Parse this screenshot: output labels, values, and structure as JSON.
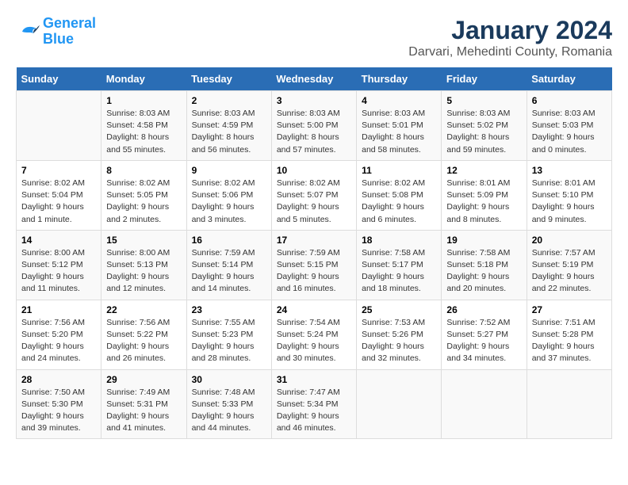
{
  "logo": {
    "line1": "General",
    "line2": "Blue"
  },
  "title": "January 2024",
  "subtitle": "Darvari, Mehedinti County, Romania",
  "header_days": [
    "Sunday",
    "Monday",
    "Tuesday",
    "Wednesday",
    "Thursday",
    "Friday",
    "Saturday"
  ],
  "weeks": [
    [
      {
        "day": "",
        "info": ""
      },
      {
        "day": "1",
        "info": "Sunrise: 8:03 AM\nSunset: 4:58 PM\nDaylight: 8 hours\nand 55 minutes."
      },
      {
        "day": "2",
        "info": "Sunrise: 8:03 AM\nSunset: 4:59 PM\nDaylight: 8 hours\nand 56 minutes."
      },
      {
        "day": "3",
        "info": "Sunrise: 8:03 AM\nSunset: 5:00 PM\nDaylight: 8 hours\nand 57 minutes."
      },
      {
        "day": "4",
        "info": "Sunrise: 8:03 AM\nSunset: 5:01 PM\nDaylight: 8 hours\nand 58 minutes."
      },
      {
        "day": "5",
        "info": "Sunrise: 8:03 AM\nSunset: 5:02 PM\nDaylight: 8 hours\nand 59 minutes."
      },
      {
        "day": "6",
        "info": "Sunrise: 8:03 AM\nSunset: 5:03 PM\nDaylight: 9 hours\nand 0 minutes."
      }
    ],
    [
      {
        "day": "7",
        "info": "Sunrise: 8:02 AM\nSunset: 5:04 PM\nDaylight: 9 hours\nand 1 minute."
      },
      {
        "day": "8",
        "info": "Sunrise: 8:02 AM\nSunset: 5:05 PM\nDaylight: 9 hours\nand 2 minutes."
      },
      {
        "day": "9",
        "info": "Sunrise: 8:02 AM\nSunset: 5:06 PM\nDaylight: 9 hours\nand 3 minutes."
      },
      {
        "day": "10",
        "info": "Sunrise: 8:02 AM\nSunset: 5:07 PM\nDaylight: 9 hours\nand 5 minutes."
      },
      {
        "day": "11",
        "info": "Sunrise: 8:02 AM\nSunset: 5:08 PM\nDaylight: 9 hours\nand 6 minutes."
      },
      {
        "day": "12",
        "info": "Sunrise: 8:01 AM\nSunset: 5:09 PM\nDaylight: 9 hours\nand 8 minutes."
      },
      {
        "day": "13",
        "info": "Sunrise: 8:01 AM\nSunset: 5:10 PM\nDaylight: 9 hours\nand 9 minutes."
      }
    ],
    [
      {
        "day": "14",
        "info": "Sunrise: 8:00 AM\nSunset: 5:12 PM\nDaylight: 9 hours\nand 11 minutes."
      },
      {
        "day": "15",
        "info": "Sunrise: 8:00 AM\nSunset: 5:13 PM\nDaylight: 9 hours\nand 12 minutes."
      },
      {
        "day": "16",
        "info": "Sunrise: 7:59 AM\nSunset: 5:14 PM\nDaylight: 9 hours\nand 14 minutes."
      },
      {
        "day": "17",
        "info": "Sunrise: 7:59 AM\nSunset: 5:15 PM\nDaylight: 9 hours\nand 16 minutes."
      },
      {
        "day": "18",
        "info": "Sunrise: 7:58 AM\nSunset: 5:17 PM\nDaylight: 9 hours\nand 18 minutes."
      },
      {
        "day": "19",
        "info": "Sunrise: 7:58 AM\nSunset: 5:18 PM\nDaylight: 9 hours\nand 20 minutes."
      },
      {
        "day": "20",
        "info": "Sunrise: 7:57 AM\nSunset: 5:19 PM\nDaylight: 9 hours\nand 22 minutes."
      }
    ],
    [
      {
        "day": "21",
        "info": "Sunrise: 7:56 AM\nSunset: 5:20 PM\nDaylight: 9 hours\nand 24 minutes."
      },
      {
        "day": "22",
        "info": "Sunrise: 7:56 AM\nSunset: 5:22 PM\nDaylight: 9 hours\nand 26 minutes."
      },
      {
        "day": "23",
        "info": "Sunrise: 7:55 AM\nSunset: 5:23 PM\nDaylight: 9 hours\nand 28 minutes."
      },
      {
        "day": "24",
        "info": "Sunrise: 7:54 AM\nSunset: 5:24 PM\nDaylight: 9 hours\nand 30 minutes."
      },
      {
        "day": "25",
        "info": "Sunrise: 7:53 AM\nSunset: 5:26 PM\nDaylight: 9 hours\nand 32 minutes."
      },
      {
        "day": "26",
        "info": "Sunrise: 7:52 AM\nSunset: 5:27 PM\nDaylight: 9 hours\nand 34 minutes."
      },
      {
        "day": "27",
        "info": "Sunrise: 7:51 AM\nSunset: 5:28 PM\nDaylight: 9 hours\nand 37 minutes."
      }
    ],
    [
      {
        "day": "28",
        "info": "Sunrise: 7:50 AM\nSunset: 5:30 PM\nDaylight: 9 hours\nand 39 minutes."
      },
      {
        "day": "29",
        "info": "Sunrise: 7:49 AM\nSunset: 5:31 PM\nDaylight: 9 hours\nand 41 minutes."
      },
      {
        "day": "30",
        "info": "Sunrise: 7:48 AM\nSunset: 5:33 PM\nDaylight: 9 hours\nand 44 minutes."
      },
      {
        "day": "31",
        "info": "Sunrise: 7:47 AM\nSunset: 5:34 PM\nDaylight: 9 hours\nand 46 minutes."
      },
      {
        "day": "",
        "info": ""
      },
      {
        "day": "",
        "info": ""
      },
      {
        "day": "",
        "info": ""
      }
    ]
  ]
}
